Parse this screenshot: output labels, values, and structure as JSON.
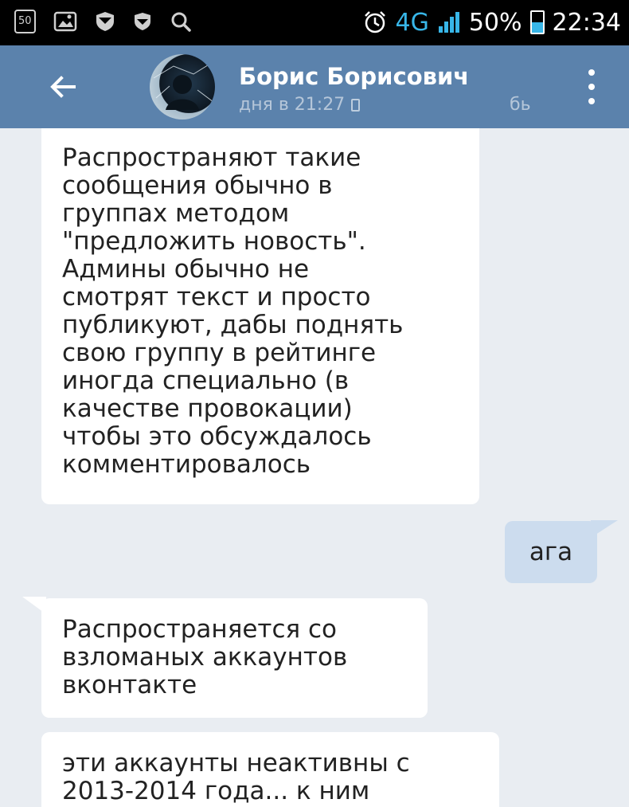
{
  "status_bar": {
    "left_icons": [
      "box-50-icon",
      "image-icon",
      "shield-icon",
      "shield-icon",
      "search-icon"
    ],
    "box_label": "50",
    "network": "4G",
    "battery_percent": "50%",
    "battery_level": 0.5,
    "time": "22:34"
  },
  "header": {
    "contact_name": "Борис Борисович",
    "last_seen": "дня в 21:27",
    "extra_text": "бь"
  },
  "messages": [
    {
      "direction": "in",
      "text": "Распространяют такие\nсообщения обычно в\nгруппах методом\n\"предложить новость\".\nАдмины обычно не\nсмотрят текст и просто\nпубликуют, дабы поднять\nсвою группу в рейтинге\nиногда специально (в\nкачестве провокации)\nчтобы это обсуждалось\nкомментировалось"
    },
    {
      "direction": "out",
      "text": "ага"
    },
    {
      "direction": "in",
      "text": "Распространяется со\nвзломаных аккаунтов\nвконтакте"
    },
    {
      "direction": "in",
      "text": "эти аккаунты неактивны с\n2013-2014 года... к ним"
    }
  ],
  "colors": {
    "app_bar": "#5b82ac",
    "out_bubble": "#ccdcee",
    "background": "#e9edf2",
    "accent": "#38b6e8"
  }
}
